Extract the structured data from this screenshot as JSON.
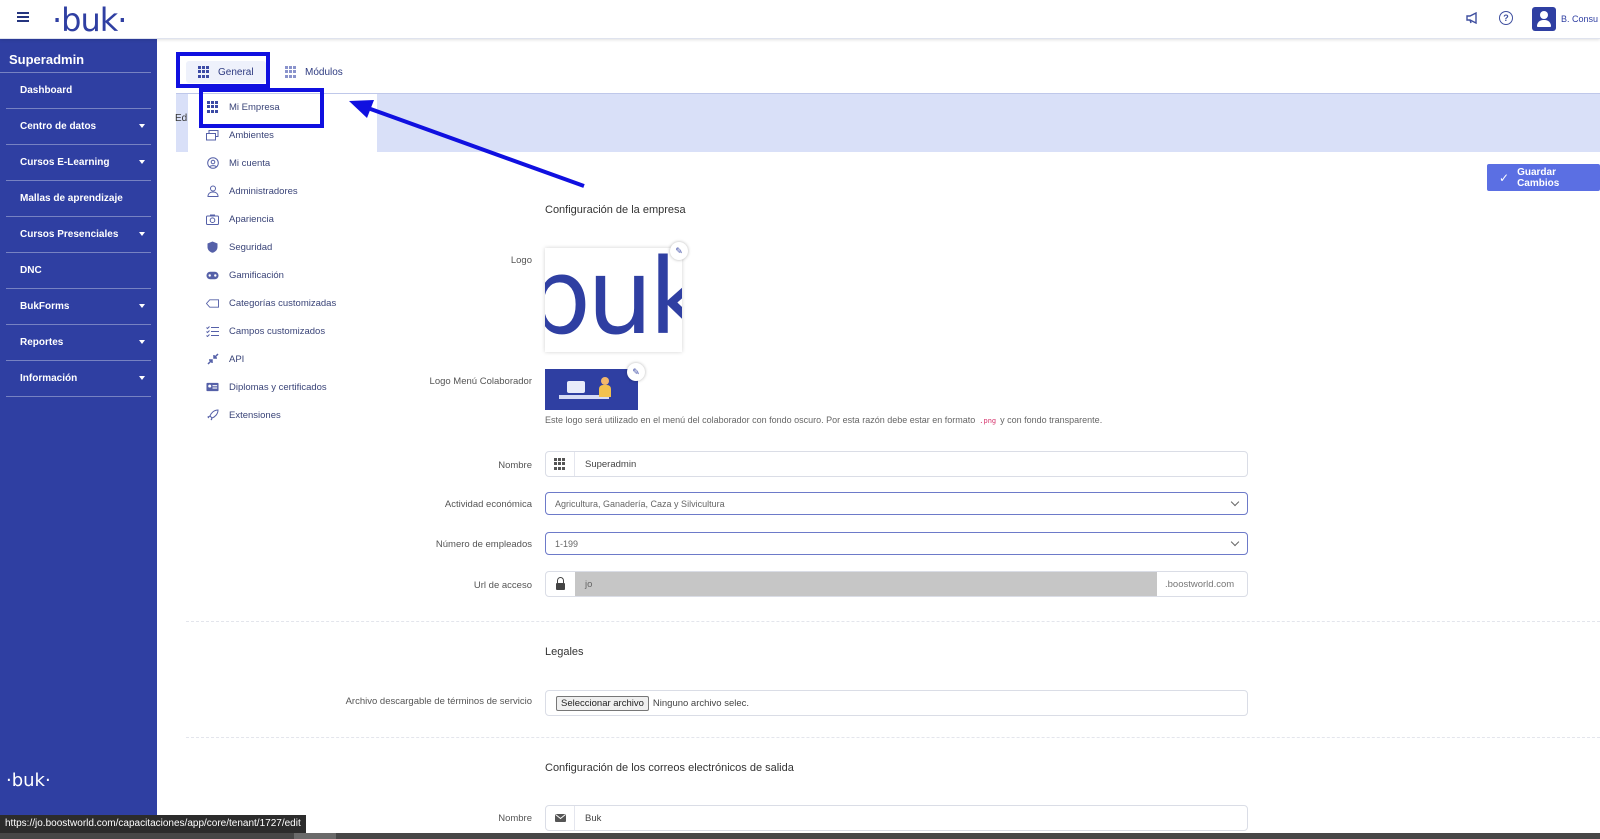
{
  "topbar": {
    "brand": "·buk·",
    "user_name": "B. Consu"
  },
  "sidebar": {
    "title": "Superadmin",
    "items": [
      {
        "label": "Dashboard"
      },
      {
        "label": "Centro de datos"
      },
      {
        "label": "Cursos E-Learning"
      },
      {
        "label": "Mallas de aprendizaje"
      },
      {
        "label": "Cursos Presenciales"
      },
      {
        "label": "DNC"
      },
      {
        "label": "BukForms"
      },
      {
        "label": "Reportes"
      },
      {
        "label": "Información"
      }
    ],
    "footer_logo": "·buk·"
  },
  "tabs": {
    "general": "General",
    "modulos": "Módulos"
  },
  "edit_label": "Ed",
  "dropdown": {
    "items": [
      {
        "label": "Mi Empresa",
        "icon": "grid-icon"
      },
      {
        "label": "Ambientes",
        "icon": "windows-icon"
      },
      {
        "label": "Mi cuenta",
        "icon": "user-circle-icon"
      },
      {
        "label": "Administradores",
        "icon": "admin-user-icon"
      },
      {
        "label": "Apariencia",
        "icon": "camera-icon"
      },
      {
        "label": "Seguridad",
        "icon": "shield-icon"
      },
      {
        "label": "Gamificación",
        "icon": "gamepad-icon"
      },
      {
        "label": "Categorías customizadas",
        "icon": "tag-icon"
      },
      {
        "label": "Campos customizados",
        "icon": "list-icon"
      },
      {
        "label": "API",
        "icon": "arrows-icon"
      },
      {
        "label": "Diplomas y certificados",
        "icon": "id-card-icon"
      },
      {
        "label": "Extensiones",
        "icon": "rocket-icon"
      }
    ]
  },
  "save_button": "Guardar Cambios",
  "company": {
    "section_title": "Configuración de la empresa",
    "logo_label": "Logo",
    "logo_text": "buk",
    "colab_logo_label": "Logo Menú Colaborador",
    "help_text_before": "Este logo será utilizado en el menú del colaborador con fondo oscuro. Por esta razón debe estar en formato",
    "help_code": ".png",
    "help_text_after": "y con fondo transparente.",
    "name_label": "Nombre",
    "name_value": "Superadmin",
    "activity_label": "Actividad económica",
    "activity_value": "Agricultura, Ganadería, Caza y Silvicultura",
    "employees_label": "Número de empleados",
    "employees_value": "1-199",
    "url_label": "Url de acceso",
    "url_value": "jo",
    "url_suffix": ".boostworld.com"
  },
  "legal": {
    "section_title": "Legales",
    "terms_label": "Archivo descargable de términos de servicio",
    "file_button": "Seleccionar archivo",
    "file_status": "Ninguno archivo selec."
  },
  "email": {
    "section_title": "Configuración de los correos electrónicos de salida",
    "name_label": "Nombre",
    "name_value": "Buk"
  },
  "status_url": "https://jo.boostworld.com/capacitaciones/app/core/tenant/1727/edit",
  "colors": {
    "brand": "#2f3fa2",
    "highlight": "#1010e0",
    "save": "#5b6fe3"
  }
}
